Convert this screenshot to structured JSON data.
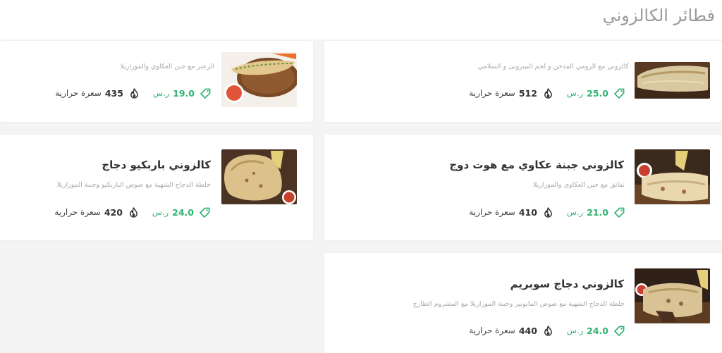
{
  "section": {
    "title": "فطائر الكالزوني"
  },
  "colors": {
    "accent": "#2fb470",
    "title_gray": "#9a9a9a",
    "desc_gray": "#a8a8a8"
  },
  "icons": {
    "price": "price-tag-icon",
    "calories": "flame-icon"
  },
  "items": [
    {
      "name": "",
      "description": "كالزوني مع الرومي المدخن و لحم البيبرونى و السلامي",
      "price": "25.0",
      "currency": "ر.س",
      "calories": "512",
      "calories_label": "سعرة حرارية"
    },
    {
      "name": "",
      "description": "الزعتر مع جبن العكاوي والموزاريلا",
      "price": "19.0",
      "currency": "ر.س",
      "calories": "435",
      "calories_label": "سعرة حرارية"
    },
    {
      "name": "كالزوني جبنة عكاوي مع هوت دوج",
      "description": "نقانق مع جبن العكاوي والموزاريلا",
      "price": "21.0",
      "currency": "ر.س",
      "calories": "410",
      "calories_label": "سعرة حرارية"
    },
    {
      "name": "كالزوني باربكيو دجاج",
      "description": "خلطة الدجاج الشهية مع صوص الباربكيو وجبنة الموزاريلا",
      "price": "24.0",
      "currency": "ر.س",
      "calories": "420",
      "calories_label": "سعرة حرارية"
    },
    {
      "name": "كالزوني دجاج سوبريم",
      "description": "خلطة الدجاج الشهية مع صوص المايونيز وجبنة الموزاريلا مع المشروم الطازج",
      "price": "24.0",
      "currency": "ر.س",
      "calories": "440",
      "calories_label": "سعرة حرارية"
    }
  ]
}
